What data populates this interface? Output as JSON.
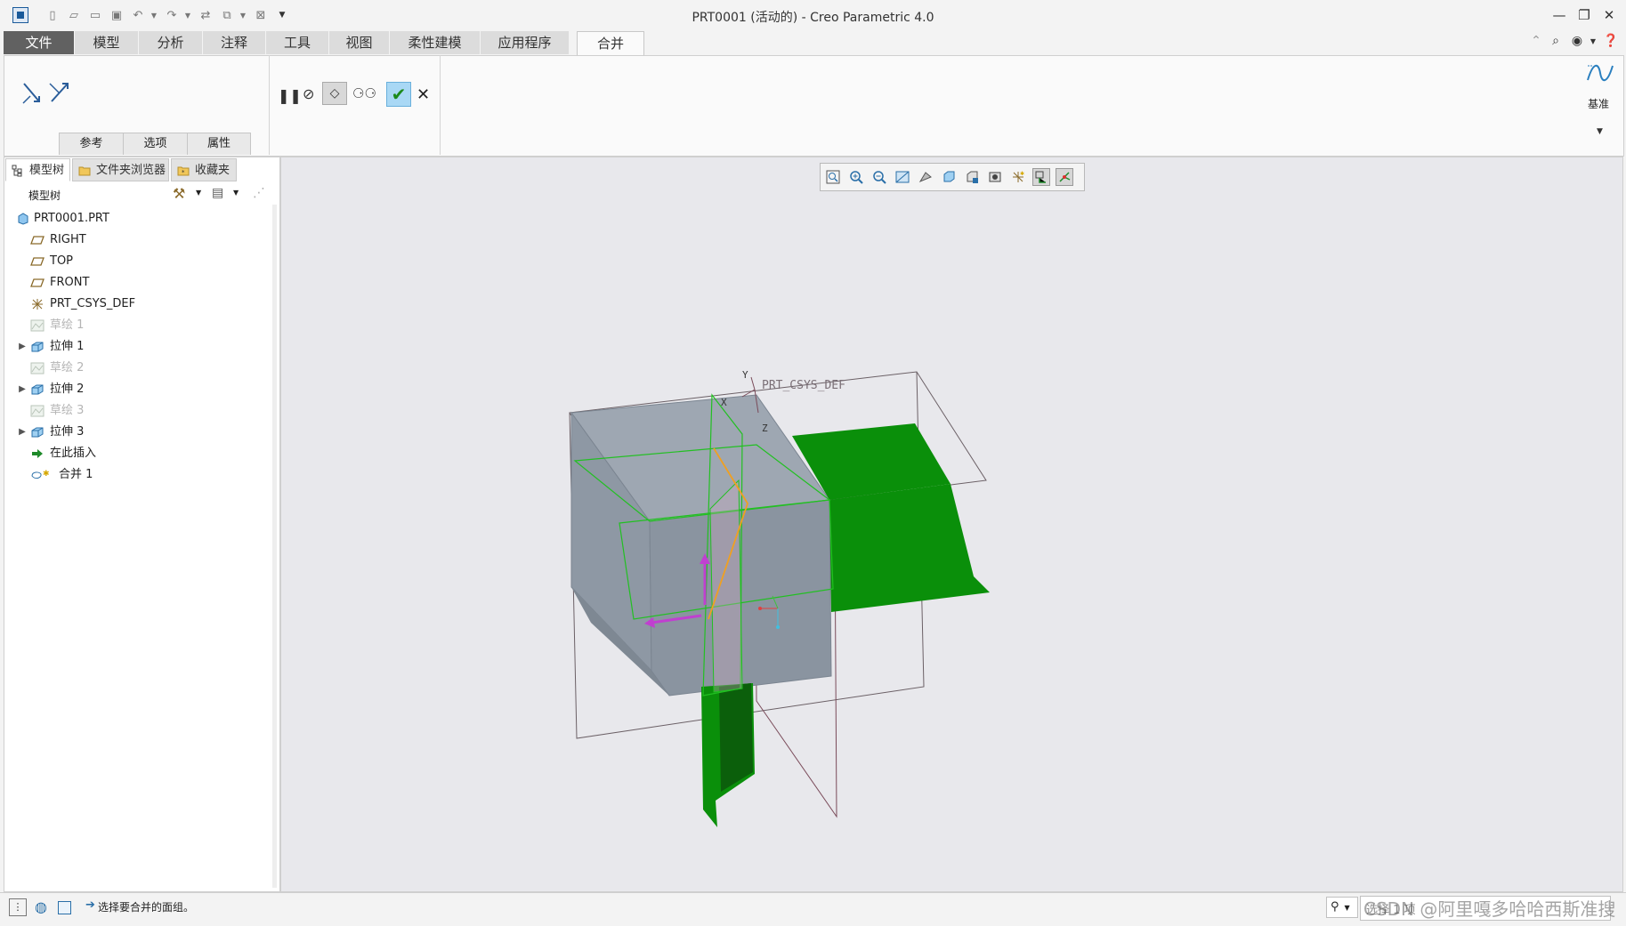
{
  "window": {
    "title": "PRT0001 (活动的) - Creo Parametric 4.0"
  },
  "ribbon_tabs": [
    "文件",
    "模型",
    "分析",
    "注释",
    "工具",
    "视图",
    "柔性建模",
    "应用程序",
    "合并"
  ],
  "active_tab": "合并",
  "ribbon": {
    "sub_tabs": [
      "参考",
      "选项",
      "属性"
    ],
    "datum_label": "基准"
  },
  "panel_tabs": [
    "模型树",
    "文件夹浏览器",
    "收藏夹"
  ],
  "model_tree": {
    "header": "模型树",
    "items": [
      {
        "label": "PRT0001.PRT",
        "type": "part"
      },
      {
        "label": "RIGHT",
        "type": "plane"
      },
      {
        "label": "TOP",
        "type": "plane"
      },
      {
        "label": "FRONT",
        "type": "plane"
      },
      {
        "label": "PRT_CSYS_DEF",
        "type": "csys"
      },
      {
        "label": "草绘 1",
        "type": "sketch",
        "dim": true
      },
      {
        "label": "拉伸 1",
        "type": "extrude",
        "expandable": true
      },
      {
        "label": "草绘 2",
        "type": "sketch",
        "dim": true
      },
      {
        "label": "拉伸 2",
        "type": "extrude",
        "expandable": true
      },
      {
        "label": "草绘 3",
        "type": "sketch",
        "dim": true
      },
      {
        "label": "拉伸 3",
        "type": "extrude",
        "expandable": true
      },
      {
        "label": "在此插入",
        "type": "insert"
      },
      {
        "label": "合并 1",
        "type": "merge"
      }
    ]
  },
  "viewport": {
    "csys_label": "PRT_CSYS_DEF",
    "axis_x": "X",
    "axis_y": "Y",
    "axis_z": "Z"
  },
  "status": {
    "message": "选择要合并的面组。"
  },
  "filter": {
    "value": "选择 1 项"
  },
  "watermark": "CSDN @阿里嘎多哈哈西斯准搜"
}
